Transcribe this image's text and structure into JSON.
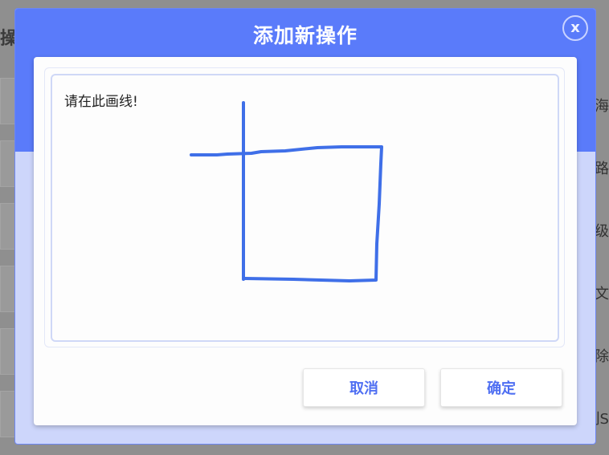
{
  "background": {
    "title": "操作",
    "right_texts": [
      "上海",
      "级路",
      "超级",
      "发文",
      "删除",
      "创S"
    ]
  },
  "modal": {
    "title": "添加新操作",
    "close_label": "x",
    "canvas_hint": "请在此画线!",
    "cancel_label": "取消",
    "confirm_label": "确定"
  },
  "colors": {
    "header": "#5a7bfa",
    "stroke": "#3f6fe8",
    "button_text": "#4f6ff2"
  }
}
